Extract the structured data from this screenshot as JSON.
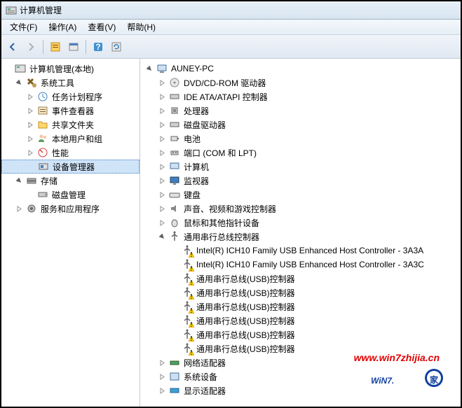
{
  "title": "计算机管理",
  "menu": {
    "file": "文件(F)",
    "action": "操作(A)",
    "view": "查看(V)",
    "help": "帮助(H)"
  },
  "left": {
    "root": "计算机管理(本地)",
    "systools": "系统工具",
    "sched": "任务计划程序",
    "eventv": "事件查看器",
    "shared": "共享文件夹",
    "users": "本地用户和组",
    "perf": "性能",
    "devmgr": "设备管理器",
    "storage": "存储",
    "diskmgr": "磁盘管理",
    "services": "服务和应用程序"
  },
  "right": {
    "root": "AUNEY-PC",
    "dvd": "DVD/CD-ROM 驱动器",
    "ide": "IDE ATA/ATAPI 控制器",
    "cpu": "处理器",
    "disk": "磁盘驱动器",
    "batt": "电池",
    "ports": "端口 (COM 和 LPT)",
    "computer": "计算机",
    "monitor": "监视器",
    "keyboard": "键盘",
    "sound": "声音、视频和游戏控制器",
    "mouse": "鼠标和其他指针设备",
    "usb": "通用串行总线控制器",
    "usb_items": [
      "Intel(R) ICH10 Family USB Enhanced Host Controller - 3A3A",
      "Intel(R) ICH10 Family USB Enhanced Host Controller - 3A3C",
      "通用串行总线(USB)控制器",
      "通用串行总线(USB)控制器",
      "通用串行总线(USB)控制器",
      "通用串行总线(USB)控制器",
      "通用串行总线(USB)控制器",
      "通用串行总线(USB)控制器"
    ],
    "net": "网络适配器",
    "sysdev": "系统设备",
    "display": "显示适配器"
  },
  "watermark": {
    "url": "www.win7zhijia.cn",
    "logo_main": "WiN7.",
    "logo_sub": "家"
  }
}
